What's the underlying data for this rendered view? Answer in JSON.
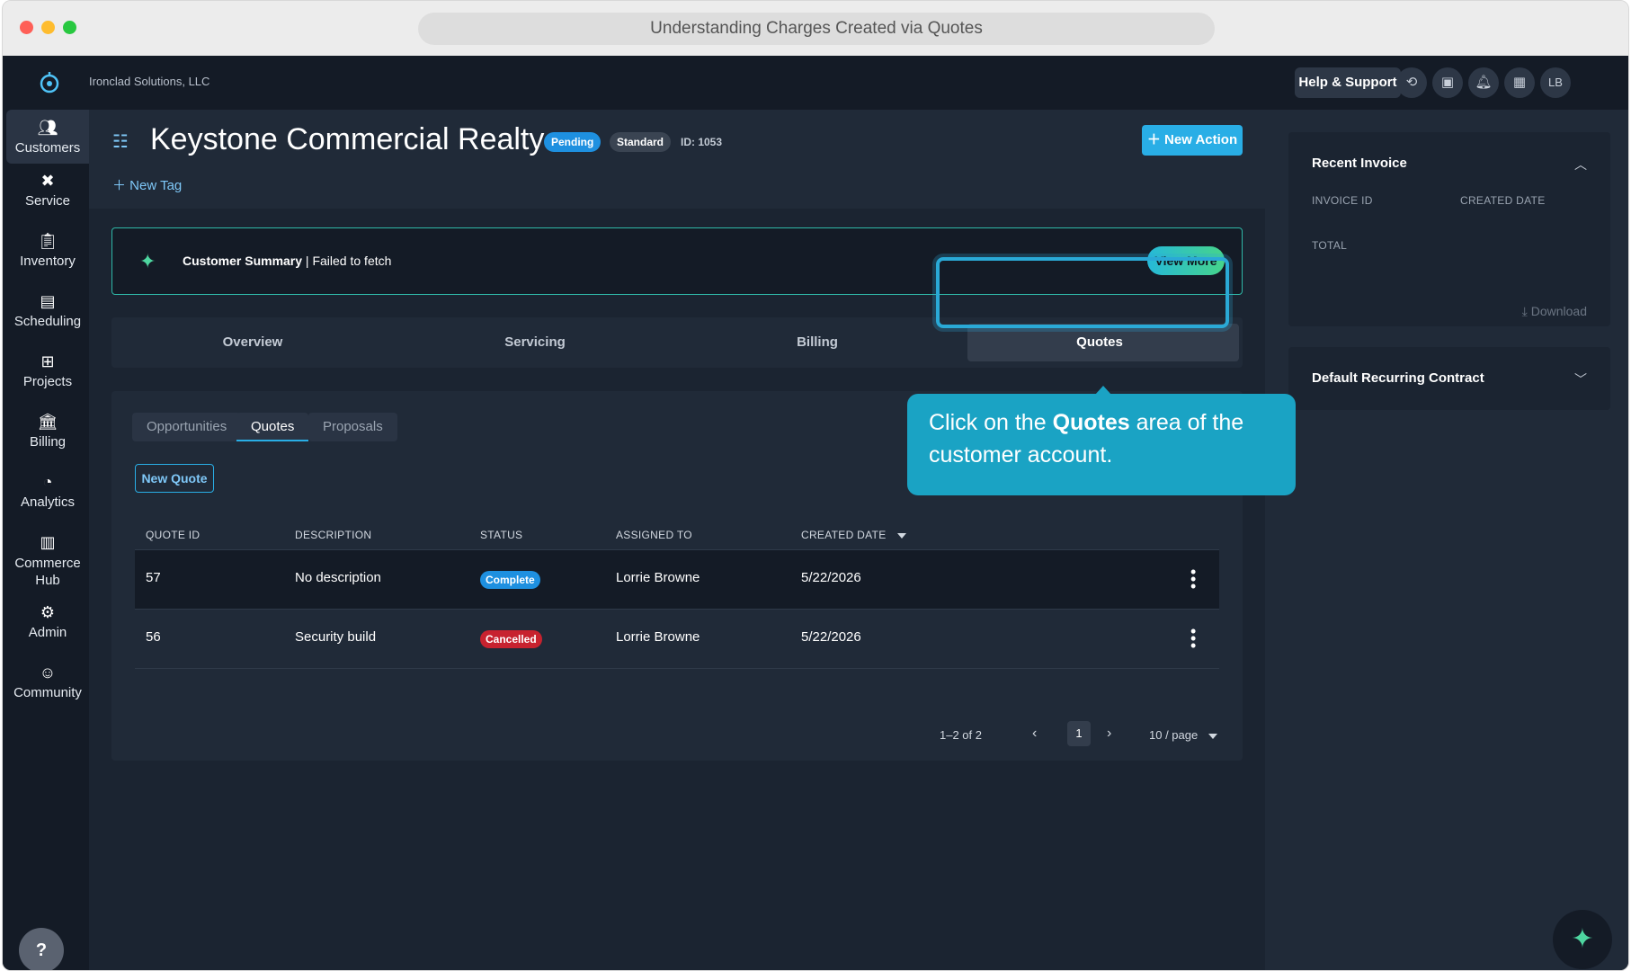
{
  "browser": {
    "title": "Understanding Charges Created via Quotes"
  },
  "topbar": {
    "company": "Ironclad Solutions, LLC",
    "help_label": "Help & Support",
    "avatar": "LB",
    "icons": [
      "history-icon",
      "camera-icon",
      "bell-icon",
      "dashboard-icon"
    ]
  },
  "sidebar": {
    "items": [
      {
        "label": "Customers",
        "icon": "customers-icon"
      },
      {
        "label": "Service",
        "icon": "service-icon"
      },
      {
        "label": "Inventory",
        "icon": "inventory-icon"
      },
      {
        "label": "Scheduling",
        "icon": "calendar-icon"
      },
      {
        "label": "Projects",
        "icon": "projects-icon"
      },
      {
        "label": "Billing",
        "icon": "bank-icon"
      },
      {
        "label": "Analytics",
        "icon": "pie-chart-icon"
      },
      {
        "label": "Commerce Hub",
        "icon": "store-icon"
      },
      {
        "label": "Admin",
        "icon": "admin-icon"
      },
      {
        "label": "Community",
        "icon": "community-icon"
      }
    ],
    "help_glyph": "?"
  },
  "header": {
    "customer_name": "Keystone Commercial Realty",
    "status_badge": "Pending",
    "type_badge": "Standard",
    "id_label": "ID: 1053",
    "new_tag_label": "New Tag",
    "new_action_label": "New Action"
  },
  "summary": {
    "title": "Customer Summary",
    "message": " | Failed to fetch",
    "button_label": "View More"
  },
  "tabs": [
    {
      "label": "Overview"
    },
    {
      "label": "Servicing"
    },
    {
      "label": "Billing"
    },
    {
      "label": "Quotes",
      "active": true
    }
  ],
  "subtabs": [
    {
      "label": "Opportunities"
    },
    {
      "label": "Quotes",
      "active": true
    },
    {
      "label": "Proposals"
    }
  ],
  "new_quote_label": "New Quote",
  "table": {
    "headers": [
      "QUOTE ID",
      "DESCRIPTION",
      "STATUS",
      "ASSIGNED TO",
      "CREATED DATE"
    ],
    "rows": [
      {
        "id": "57",
        "description": "No description",
        "status": "Complete",
        "assigned": "Lorrie Browne",
        "created": "5/22/2026"
      },
      {
        "id": "56",
        "description": "Security build",
        "status": "Cancelled",
        "assigned": "Lorrie Browne",
        "created": "5/22/2026"
      }
    ]
  },
  "pagination": {
    "range": "1–2 of 2",
    "page": "1",
    "per_page": "10 / page"
  },
  "tooltip": {
    "before": "Click on the ",
    "bold": "Quotes",
    "after": " area of the customer account."
  },
  "right_panel": {
    "recent_invoice": {
      "title": "Recent Invoice",
      "invoice_id_label": "INVOICE ID",
      "created_date_label": "CREATED DATE",
      "total_label": "TOTAL",
      "download_label": "Download"
    },
    "contract": {
      "title": "Default Recurring Contract"
    }
  },
  "colors": {
    "accent": "#29aee6",
    "complete": "#1e90e0",
    "cancelled": "#c7222f",
    "tooltip": "#1aa3c4"
  }
}
